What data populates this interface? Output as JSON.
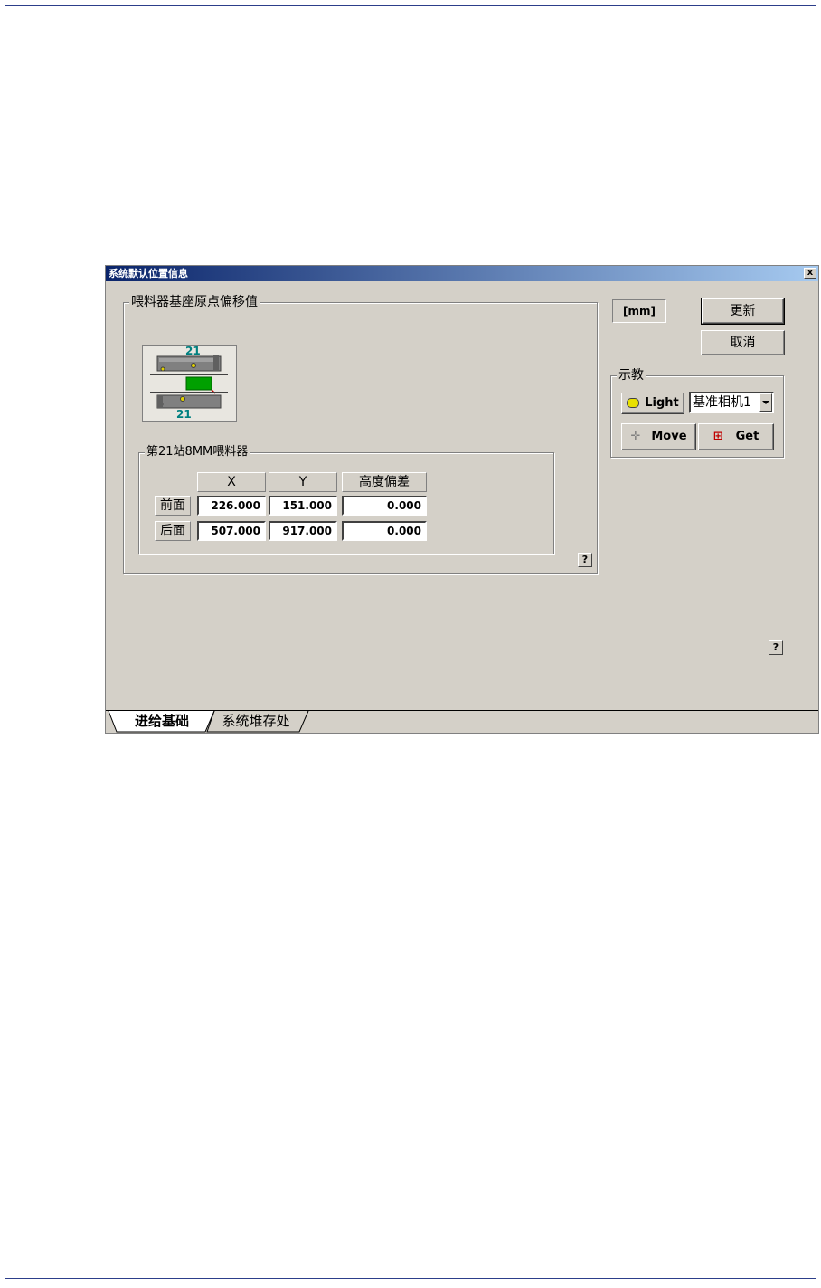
{
  "window": {
    "title": "系统默认位置信息",
    "close_glyph": "x"
  },
  "offset_group": {
    "title": "喂料器基座原点偏移值",
    "feeder_top_label": "21",
    "feeder_bottom_label": "21",
    "station_group": {
      "title": "第21站8MM喂料器",
      "columns": [
        "X",
        "Y",
        "高度偏差"
      ],
      "rows": [
        {
          "label": "前面",
          "x": "226.000",
          "y": "151.000",
          "h": "0.000"
        },
        {
          "label": "后面",
          "x": "507.000",
          "y": "917.000",
          "h": "0.000"
        }
      ]
    },
    "help": "?"
  },
  "unit_label": "[mm]",
  "buttons": {
    "update": "更新",
    "cancel": "取消"
  },
  "teach_group": {
    "title": "示教",
    "light_label": "Light",
    "camera_select": "基准相机1",
    "move_label": "Move",
    "get_label": "Get"
  },
  "help_main": "?",
  "tabs": [
    {
      "label": "进给基础",
      "active": true
    },
    {
      "label": "系统堆存处",
      "active": false
    }
  ],
  "colors": {
    "title_bar": "#0a246a",
    "dialog_bg": "#d4d0c8",
    "page_rule": "#2c3e8a"
  }
}
